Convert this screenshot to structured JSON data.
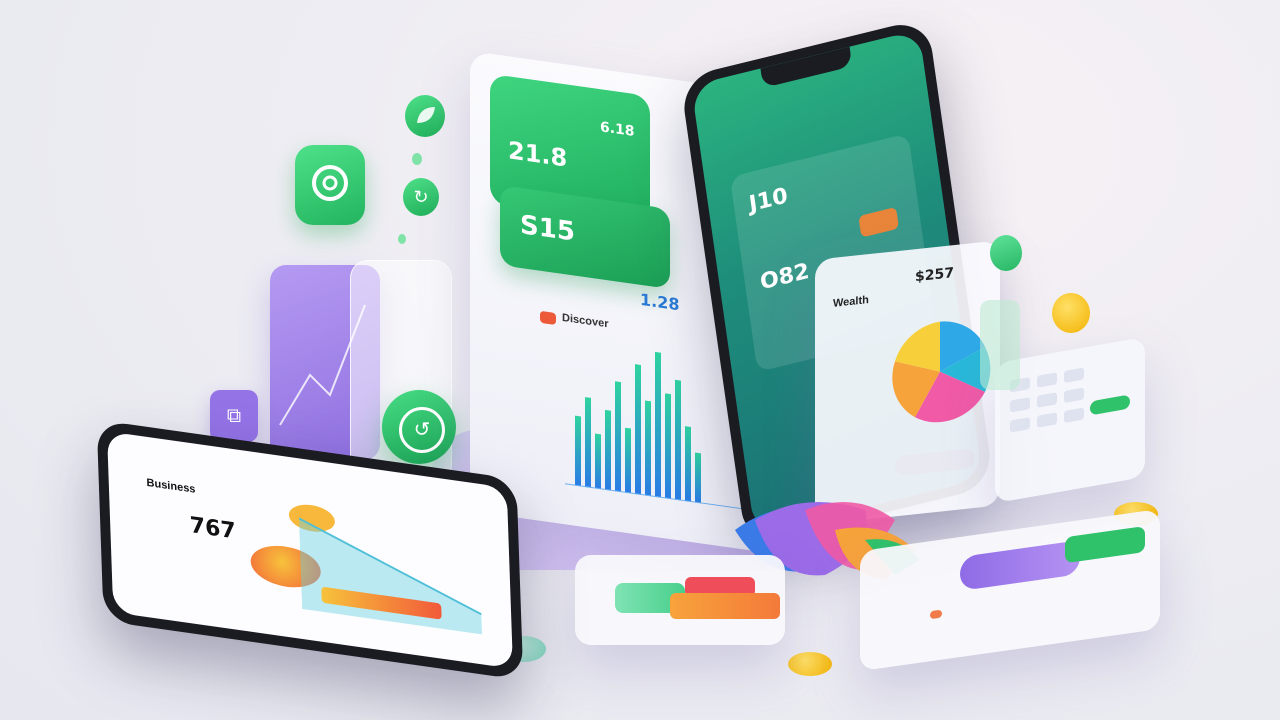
{
  "center_card": {
    "value_1": "21.8",
    "value_2": "6.18",
    "value_3": "S15",
    "total_value": "1.28",
    "section_label": "Discover"
  },
  "right_phone": {
    "value_1": "J10",
    "value_2": "O82",
    "overlay_title": "Wealth",
    "overlay_value": "$257"
  },
  "left_phone": {
    "header_text": "Business",
    "value": "767"
  },
  "colors": {
    "green": "#2fc26a",
    "teal": "#1f8f7e",
    "purple": "#9b7be8",
    "orange": "#f7a33b",
    "pink": "#f05aa6",
    "blue": "#2fa8e8"
  }
}
